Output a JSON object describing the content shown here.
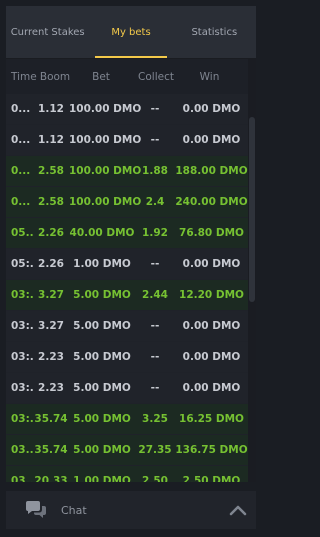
{
  "tabs": [
    {
      "label": "Current Stakes",
      "active": false
    },
    {
      "label": "My bets",
      "active": true
    },
    {
      "label": "Statistics",
      "active": false
    }
  ],
  "columns": {
    "time": "Time",
    "boom": "Boom",
    "bet": "Bet",
    "collect": "Collect",
    "win": "Win"
  },
  "rows": [
    {
      "time": "0...",
      "boom": "1.12",
      "bet": "100.00 DMO",
      "collect": "--",
      "win": "0.00 DMO",
      "status": "loss"
    },
    {
      "time": "0...",
      "boom": "1.12",
      "bet": "100.00 DMO",
      "collect": "--",
      "win": "0.00 DMO",
      "status": "loss"
    },
    {
      "time": "0...",
      "boom": "2.58",
      "bet": "100.00 DMO",
      "collect": "1.88",
      "win": "188.00 DMO",
      "status": "win"
    },
    {
      "time": "0...",
      "boom": "2.58",
      "bet": "100.00 DMO",
      "collect": "2.4",
      "win": "240.00 DMO",
      "status": "win"
    },
    {
      "time": "05...",
      "boom": "2.26",
      "bet": "40.00 DMO",
      "collect": "1.92",
      "win": "76.80 DMO",
      "status": "win"
    },
    {
      "time": "05:...",
      "boom": "2.26",
      "bet": "1.00 DMO",
      "collect": "--",
      "win": "0.00 DMO",
      "status": "loss"
    },
    {
      "time": "03:...",
      "boom": "3.27",
      "bet": "5.00 DMO",
      "collect": "2.44",
      "win": "12.20 DMO",
      "status": "win"
    },
    {
      "time": "03:...",
      "boom": "3.27",
      "bet": "5.00 DMO",
      "collect": "--",
      "win": "0.00 DMO",
      "status": "loss"
    },
    {
      "time": "03:...",
      "boom": "2.23",
      "bet": "5.00 DMO",
      "collect": "--",
      "win": "0.00 DMO",
      "status": "loss"
    },
    {
      "time": "03:...",
      "boom": "2.23",
      "bet": "5.00 DMO",
      "collect": "--",
      "win": "0.00 DMO",
      "status": "loss"
    },
    {
      "time": "03:...",
      "boom": "35.74",
      "bet": "5.00 DMO",
      "collect": "3.25",
      "win": "16.25 DMO",
      "status": "win"
    },
    {
      "time": "03...",
      "boom": "35.74",
      "bet": "5.00 DMO",
      "collect": "27.35",
      "win": "136.75 DMO",
      "status": "win"
    },
    {
      "time": "03...",
      "boom": "20.33",
      "bet": "1.00 DMO",
      "collect": "2.50",
      "win": "2.50 DMO",
      "status": "win"
    }
  ],
  "chat": {
    "label": "Chat",
    "icon": "chat-bubbles-icon",
    "toggle_icon": "chevron-up-icon"
  },
  "colors": {
    "accent": "#f3c94a",
    "win": "#76c132",
    "background": "#1a1d23"
  }
}
